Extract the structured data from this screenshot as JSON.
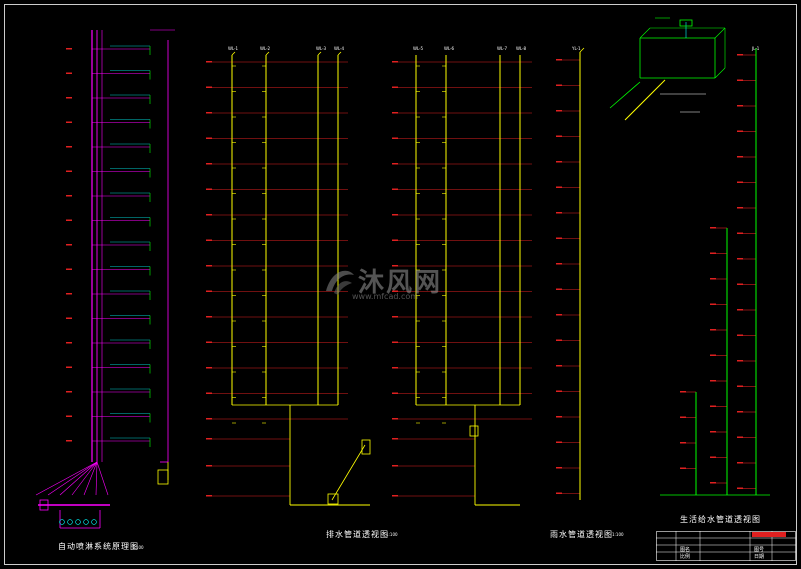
{
  "drawing": {
    "captions": {
      "sprinkler": "自动喷淋系统原理图",
      "drainage": "排水管道透视图",
      "rainwater": "雨水管道透视图",
      "water_supply": "生活给水管道透视图"
    },
    "scale_marks": [
      "1:100",
      "1:100",
      "1:100"
    ],
    "riser_labels": {
      "drainage_left": [
        "WL-1",
        "WL-2",
        "WL-3",
        "WL-4"
      ],
      "drainage_right": [
        "WL-5",
        "WL-6",
        "WL-7",
        "WL-8"
      ],
      "rainwater": "YL-1",
      "water_supply": "JL-1"
    },
    "title_block": {
      "label_a": "图名",
      "label_b": "图号",
      "label_c": "比例",
      "label_d": "日期"
    }
  },
  "watermark": {
    "brand": "沐风网",
    "url": "www.mfcad.com"
  },
  "colors": {
    "background": "#000000",
    "frame": "#ffffff",
    "floor_line": "#e02020",
    "riser_yellow": "#ffff00",
    "riser_magenta": "#ff00ff",
    "riser_green": "#00ff00",
    "branch_cyan": "#00ffff"
  }
}
